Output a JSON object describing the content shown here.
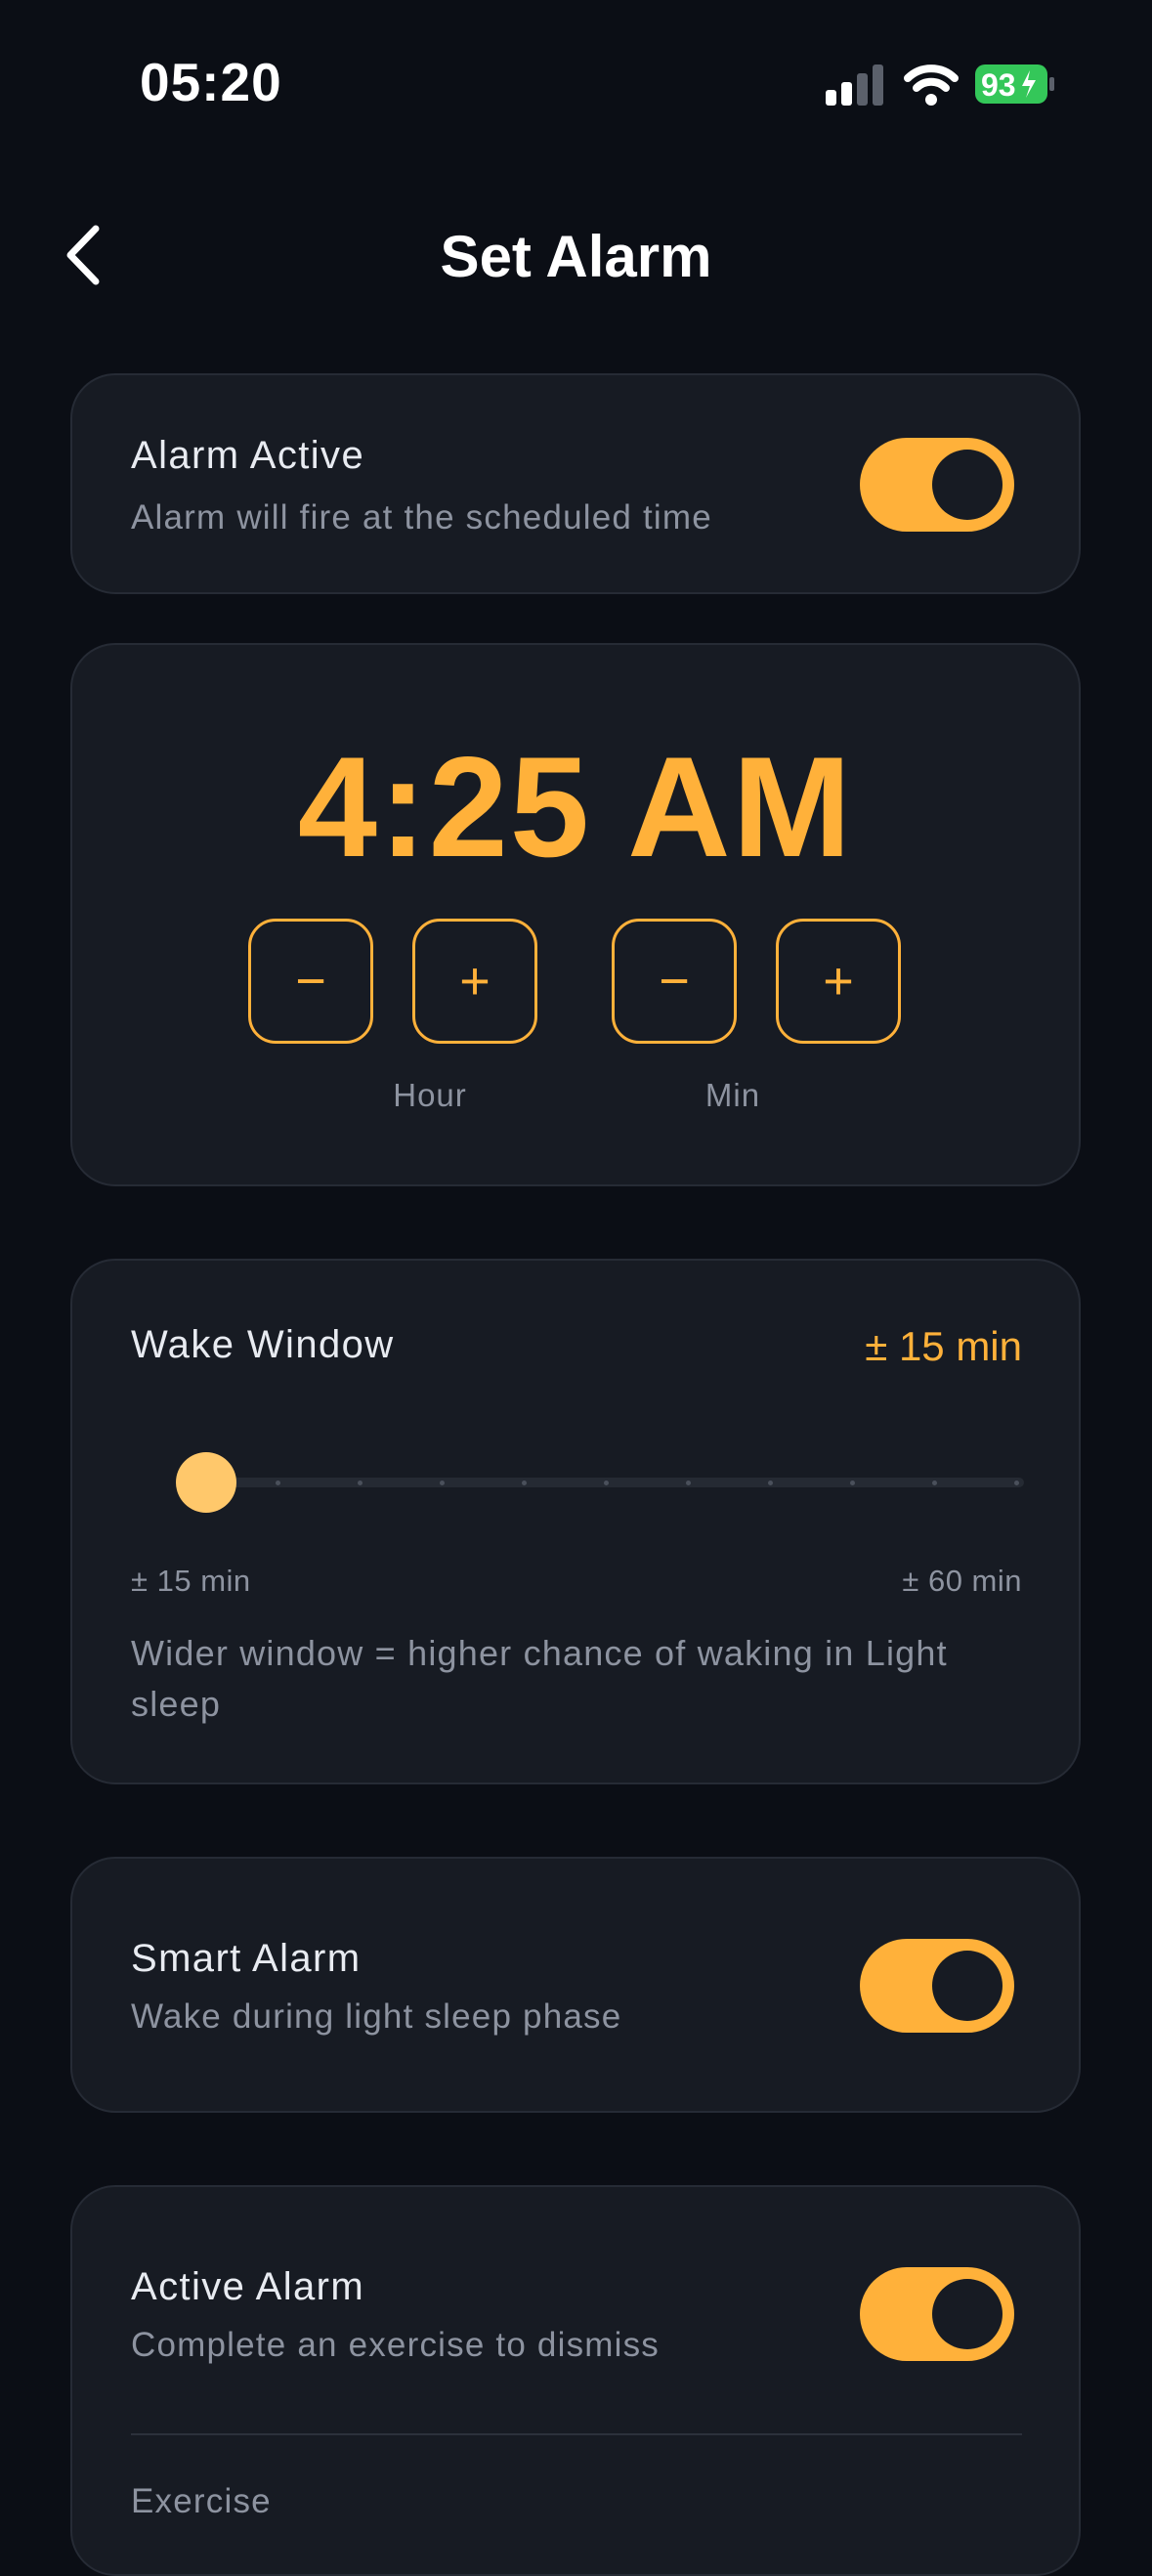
{
  "status_bar": {
    "time": "05:20",
    "battery": "93"
  },
  "header": {
    "title": "Set Alarm"
  },
  "alarm_active": {
    "title": "Alarm Active",
    "subtitle": "Alarm will fire at the scheduled time",
    "on": true
  },
  "time_card": {
    "time": "4:25 AM",
    "minus": "−",
    "plus": "+",
    "hour_label": "Hour",
    "min_label": "Min"
  },
  "wake_window": {
    "title": "Wake Window",
    "value": "± 15 min",
    "min_label": "± 15 min",
    "max_label": "± 60 min",
    "hint": "Wider window = higher chance of waking in Light sleep",
    "level": 0
  },
  "smart_alarm": {
    "title": "Smart Alarm",
    "subtitle": "Wake during light sleep phase",
    "on": true
  },
  "active_alarm": {
    "title": "Active Alarm",
    "subtitle": "Complete an exercise to dismiss",
    "on": true,
    "next_label": "Exercise"
  },
  "colors": {
    "accent": "#ffb13a",
    "background": "#0b0e15",
    "card": "#171b23"
  }
}
